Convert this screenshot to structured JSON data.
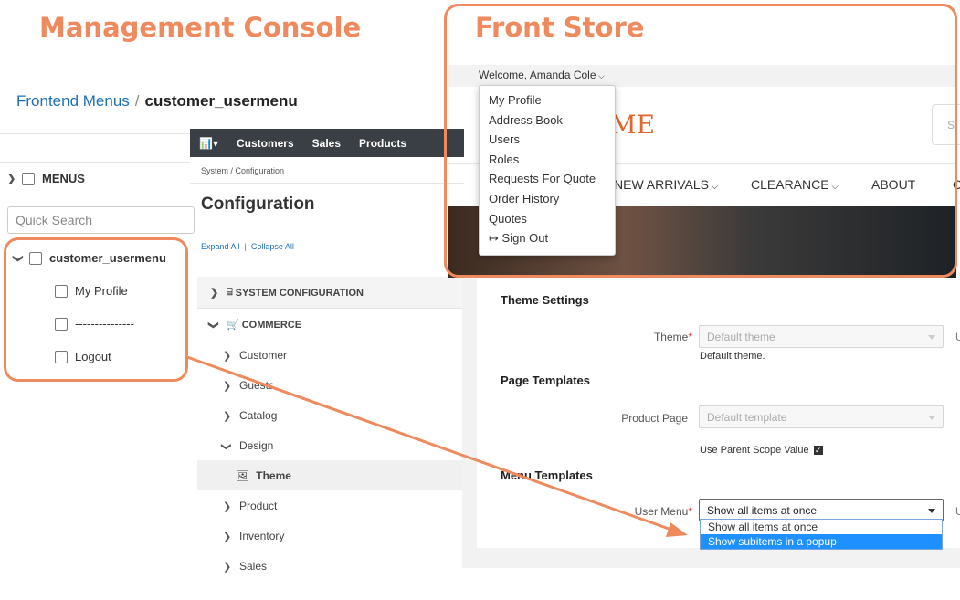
{
  "annotations": {
    "left_title": "Management Console",
    "right_title": "Front Store",
    "accent_color": "#ee8a5e"
  },
  "frontend_menus": {
    "breadcrumb_link": "Frontend Menus",
    "breadcrumb_sep": "/",
    "breadcrumb_current": "customer_usermenu",
    "menus_label": "MENUS",
    "search_placeholder": "Quick Search",
    "tree": {
      "root": "customer_usermenu",
      "children": [
        "My Profile",
        "---------------",
        "Logout"
      ]
    }
  },
  "admin": {
    "nav": [
      "Customers",
      "Sales",
      "Products"
    ],
    "nav_icon": "chart-icon",
    "breadcrumb": "System / Configuration",
    "title": "Configuration",
    "expand_all": "Expand All",
    "collapse_all": "Collapse All",
    "link_sep": "|",
    "sections": {
      "system": "SYSTEM CONFIGURATION",
      "commerce": "COMMERCE"
    },
    "side_items": [
      "Customer",
      "Guests",
      "Catalog",
      "Design",
      "Theme",
      "Product",
      "Inventory",
      "Sales"
    ]
  },
  "form": {
    "theme_settings": "Theme Settings",
    "theme_label": "Theme",
    "theme_value": "Default theme",
    "theme_hint": "Default theme.",
    "page_templates": "Page Templates",
    "product_page_label": "Product Page",
    "product_page_value": "Default template",
    "use_parent": "Use Parent Scope Value",
    "menu_templates": "Menu Templates",
    "user_menu_label": "User Menu",
    "user_menu_value": "Show all items at once",
    "options": [
      "Show all items at once",
      "Show subitems in a popup"
    ],
    "cut_label": "U"
  },
  "front_store": {
    "welcome": "Welcome, Amanda Cole",
    "popup_items": [
      "My Profile",
      "Address Book",
      "Users",
      "Roles",
      "Requests For Quote",
      "Order History",
      "Quotes"
    ],
    "sign_out": "Sign Out",
    "logo_partial": "ME",
    "search_partial": "S",
    "nav": [
      "NEW ARRIVALS",
      "CLEARANCE",
      "ABOUT"
    ],
    "nav_cut": "C"
  }
}
